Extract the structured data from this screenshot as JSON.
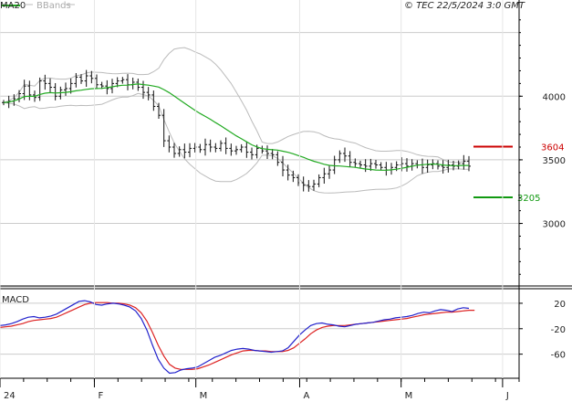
{
  "copyright": "© TEC 22/5/2024 3:0 GMT",
  "legend": {
    "ma_label": "MA20",
    "bb_label": "BBands",
    "ma_color": "#22aa22",
    "bb_color": "#bbbbbb"
  },
  "macd_label": "MACD",
  "colors": {
    "bar": "#111111",
    "ma": "#22aa22",
    "bands": "#bbbbbb",
    "grid": "#cccccc",
    "macd": "#2222cc",
    "signal": "#dd2222",
    "resistance": "#cc0000",
    "support": "#119911"
  },
  "chart_data": [
    {
      "type": "ohlc",
      "ylim": [
        2530,
        4670
      ],
      "yticks": [
        3000,
        3500,
        4000
      ],
      "ytick_labels": [
        "3000",
        "3500",
        "4000"
      ],
      "x_ticks": [
        {
          "label": "24",
          "week": 0
        },
        {
          "label": "F",
          "week": 4
        },
        {
          "label": "M",
          "week": 8.3
        },
        {
          "label": "A",
          "week": 12.7
        },
        {
          "label": "M",
          "week": 17
        },
        {
          "label": "J",
          "week": 21.3
        }
      ],
      "resistance": {
        "value": 3604,
        "label": "3604"
      },
      "support": {
        "value": 3205,
        "label": "3205"
      },
      "closes": [
        3950,
        3960,
        3980,
        4020,
        4080,
        4010,
        3990,
        4120,
        4100,
        4070,
        4000,
        4050,
        4060,
        4100,
        4150,
        4120,
        4160,
        4140,
        4090,
        4080,
        4060,
        4100,
        4120,
        4130,
        4090,
        4110,
        4070,
        4030,
        4010,
        3920,
        3850,
        3650,
        3600,
        3550,
        3580,
        3560,
        3590,
        3600,
        3580,
        3620,
        3600,
        3590,
        3630,
        3590,
        3570,
        3580,
        3600,
        3560,
        3540,
        3590,
        3570,
        3550,
        3540,
        3480,
        3420,
        3380,
        3360,
        3320,
        3300,
        3290,
        3310,
        3360,
        3390,
        3420,
        3500,
        3550,
        3530,
        3480,
        3470,
        3460,
        3450,
        3470,
        3460,
        3440,
        3420,
        3440,
        3460,
        3470,
        3450,
        3470,
        3460,
        3440,
        3460,
        3470,
        3450,
        3440,
        3460,
        3450,
        3470,
        3490,
        3450
      ],
      "series": [
        {
          "name": "MA20",
          "color": "#22aa22"
        },
        {
          "name": "BBands",
          "color": "#bbbbbb"
        }
      ]
    },
    {
      "type": "line",
      "title": "MACD",
      "ylim": [
        -95,
        40
      ],
      "yticks": [
        20,
        -20,
        -60
      ],
      "ytick_labels": [
        "20",
        "-20",
        "-60"
      ],
      "macd": [
        -15,
        -14,
        -12,
        -9,
        -5,
        -2,
        -1,
        -3,
        -2,
        0,
        3,
        8,
        13,
        18,
        23,
        24,
        22,
        18,
        17,
        19,
        20,
        19,
        17,
        14,
        8,
        -4,
        -22,
        -46,
        -68,
        -82,
        -90,
        -89,
        -85,
        -83,
        -82,
        -80,
        -75,
        -70,
        -65,
        -62,
        -58,
        -54,
        -52,
        -51,
        -52,
        -54,
        -55,
        -56,
        -57,
        -56,
        -55,
        -50,
        -40,
        -30,
        -22,
        -15,
        -12,
        -11,
        -13,
        -14,
        -16,
        -17,
        -15,
        -13,
        -12,
        -11,
        -10,
        -8,
        -6,
        -5,
        -3,
        -2,
        -1,
        1,
        4,
        6,
        5,
        8,
        10,
        9,
        7,
        11,
        13,
        12
      ],
      "signal": [
        -18,
        -17,
        -16,
        -14,
        -12,
        -9,
        -7,
        -6,
        -5,
        -4,
        -2,
        2,
        6,
        10,
        14,
        18,
        20,
        21,
        21,
        21,
        20,
        20,
        19,
        17,
        13,
        5,
        -8,
        -26,
        -46,
        -63,
        -76,
        -82,
        -84,
        -84,
        -84,
        -83,
        -80,
        -77,
        -73,
        -69,
        -65,
        -61,
        -58,
        -55,
        -54,
        -54,
        -55,
        -55,
        -56,
        -56,
        -56,
        -54,
        -50,
        -43,
        -36,
        -28,
        -22,
        -18,
        -16,
        -15,
        -15,
        -15,
        -14,
        -13,
        -12,
        -11,
        -10,
        -9,
        -8,
        -7,
        -6,
        -5,
        -4,
        -2,
        0,
        2,
        3,
        4,
        5,
        6,
        6,
        7,
        8,
        9,
        9
      ]
    }
  ]
}
